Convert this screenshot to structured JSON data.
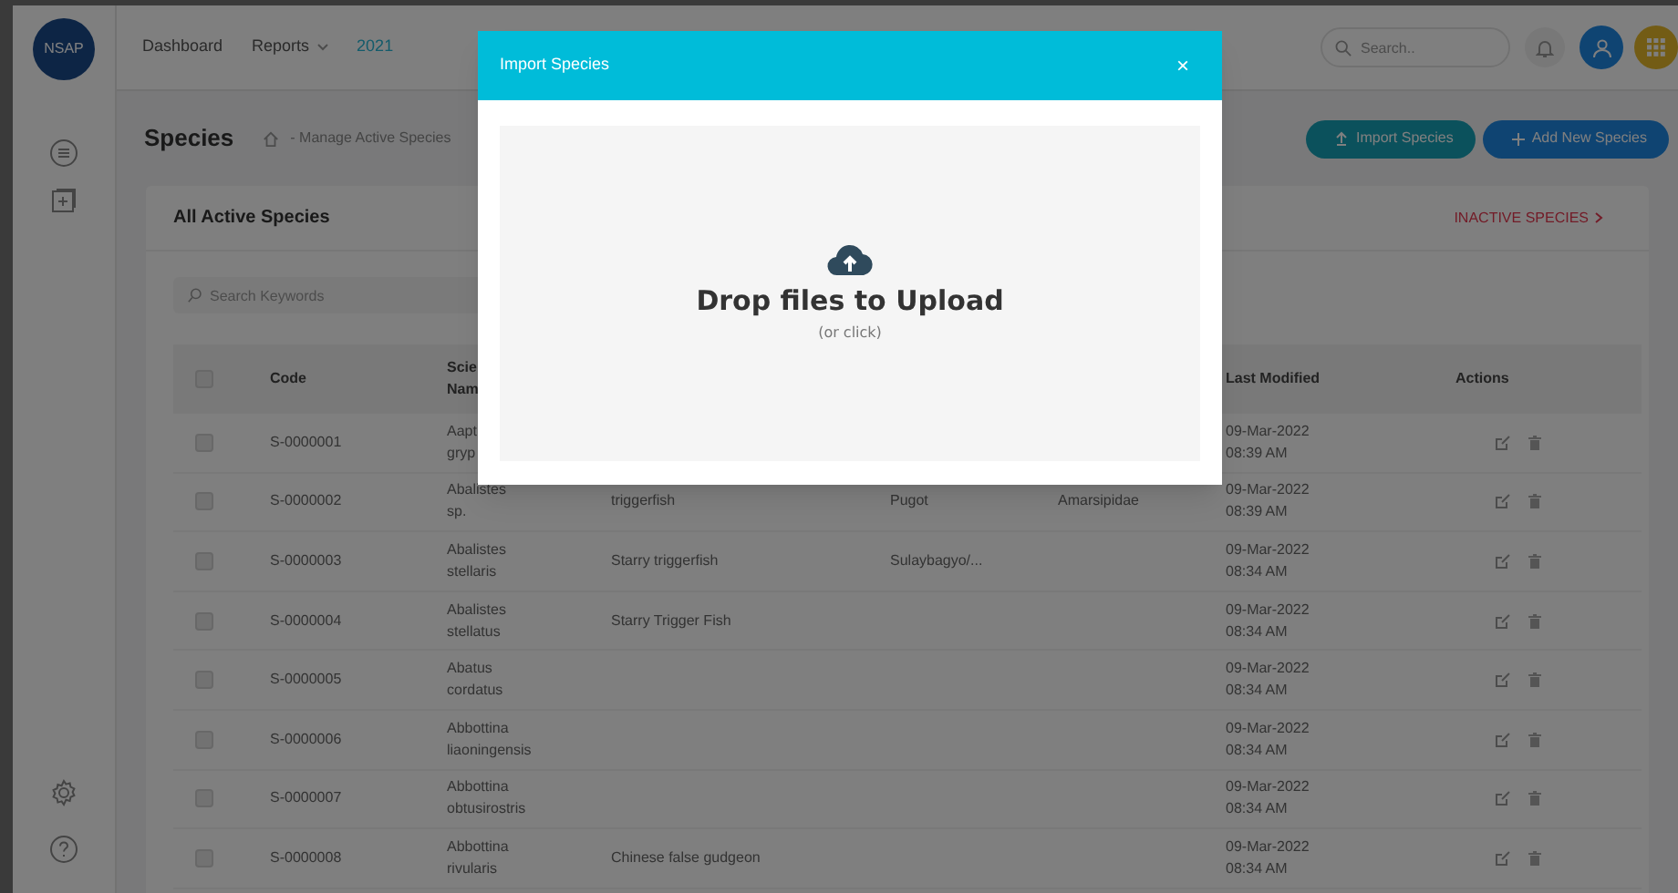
{
  "app": {
    "logo": "NSAP"
  },
  "nav": [
    {
      "label": "Dashboard",
      "kind": "link"
    },
    {
      "label": "Reports",
      "kind": "dropdown"
    },
    {
      "label": "2021",
      "kind": "year"
    }
  ],
  "search": {
    "placeholder": "Search.."
  },
  "page": {
    "title": "Species",
    "breadcrumb": "- Manage Active Species",
    "buttons": [
      {
        "label": "Import Species",
        "kind": "import"
      },
      {
        "label": "Add New Species",
        "kind": "add"
      }
    ]
  },
  "card": {
    "title": "All Active Species",
    "link": "INACTIVE SPECIES"
  },
  "table": {
    "search_placeholder": "Search Keywords",
    "select_all_checked": false,
    "columns": {
      "column_1": "Code",
      "column_2": "Scie Nam",
      "column_6": "Last Modified",
      "column_7": "Actions"
    },
    "rows": [
      {
        "checked": false,
        "column_1": "S-0000001",
        "column_2": "Aapt gryp",
        "column_6": "09-Mar-2022 08:39 AM"
      },
      {
        "checked": false,
        "column_1": "S-0000002",
        "column_2": "Abalistes sp.",
        "column_3": "triggerfish",
        "column_4": "Pugot",
        "column_5": "Amarsipidae",
        "column_6": "09-Mar-2022 08:39 AM"
      },
      {
        "checked": false,
        "column_1": "S-0000003",
        "column_2": "Abalistes stellaris",
        "column_3": "Starry triggerfish",
        "column_4": "Sulaybagyo/...",
        "column_6": "09-Mar-2022 08:34 AM"
      },
      {
        "checked": false,
        "column_1": "S-0000004",
        "column_2": "Abalistes stellatus",
        "column_3": "Starry Trigger Fish",
        "column_6": "09-Mar-2022 08:34 AM"
      },
      {
        "checked": false,
        "column_1": "S-0000005",
        "column_2": "Abatus cordatus",
        "column_6": "09-Mar-2022 08:34 AM"
      },
      {
        "checked": false,
        "column_1": "S-0000006",
        "column_2": "Abbottina liaoningensis",
        "column_6": "09-Mar-2022 08:34 AM"
      },
      {
        "checked": false,
        "column_1": "S-0000007",
        "column_2": "Abbottina obtusirostris",
        "column_6": "09-Mar-2022 08:34 AM"
      },
      {
        "checked": false,
        "column_1": "S-0000008",
        "column_2": "Abbottina rivularis",
        "column_3": "Chinese false gudgeon",
        "column_6": "09-Mar-2022 08:34 AM"
      }
    ]
  },
  "modal": {
    "title": "Import Species",
    "close": "×",
    "dropzone": {
      "title": "Drop files to Upload",
      "hint": "(or click)"
    }
  }
}
